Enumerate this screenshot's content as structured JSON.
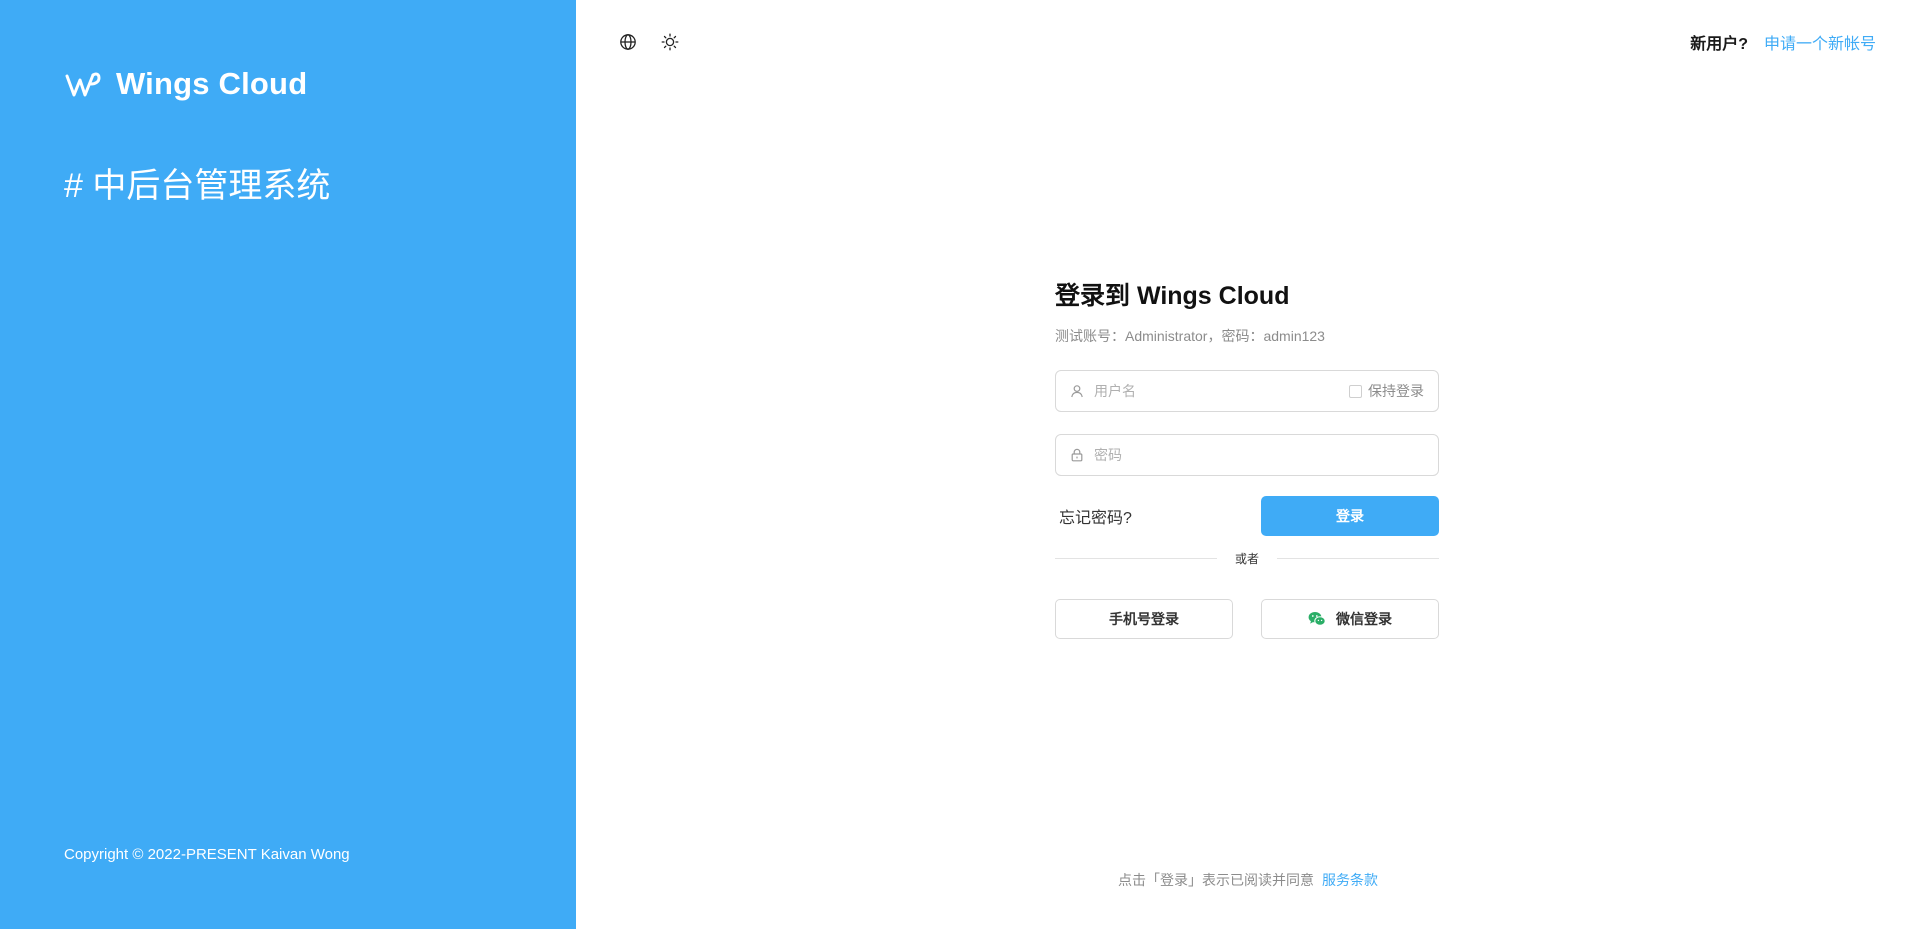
{
  "brand": {
    "name": "Wings Cloud",
    "slogan": "# 中后台管理系统",
    "copyright": "Copyright © 2022-PRESENT Kaivan Wong",
    "color": "#3fabf6"
  },
  "toolbar": {
    "language_icon": "globe-icon",
    "theme_icon": "sun-icon"
  },
  "signup": {
    "prompt": "新用户?",
    "link": "申请一个新帐号"
  },
  "login": {
    "title": "登录到 Wings Cloud",
    "hint": "测试账号：Administrator，密码：admin123",
    "username_placeholder": "用户名",
    "username_icon": "user-icon",
    "remember_label": "保持登录",
    "password_placeholder": "密码",
    "password_icon": "lock-icon",
    "forgot_label": "忘记密码?",
    "submit_label": "登录",
    "divider_text": "或者",
    "phone_login_label": "手机号登录",
    "wechat_login_label": "微信登录",
    "wechat_icon": "wechat-icon"
  },
  "footer": {
    "terms_text": "点击「登录」表示已阅读并同意",
    "terms_link": "服务条款"
  }
}
